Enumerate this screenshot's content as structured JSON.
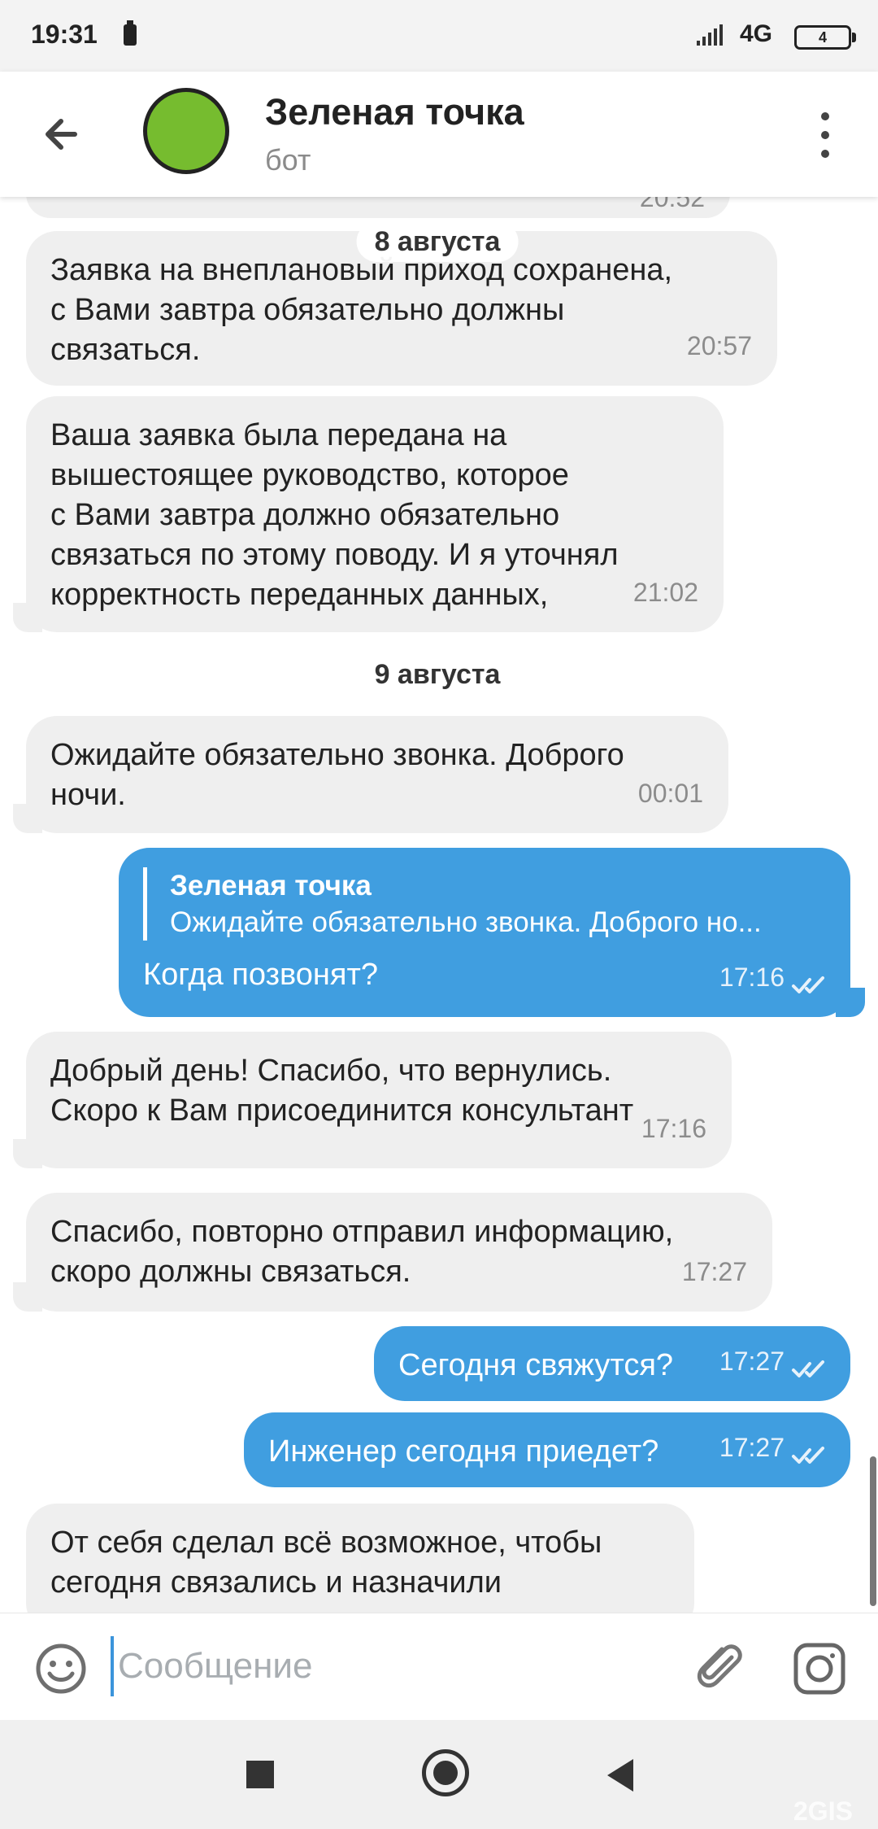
{
  "status_bar": {
    "time": "19:31",
    "network": "4G",
    "battery_level": "4",
    "signal_icon": "signal-bars-icon",
    "battery_icon": "battery-icon"
  },
  "header": {
    "title": "Зеленая точка",
    "subtitle": "бот",
    "avatar_color": "#76bc2f",
    "back_icon": "arrow-left-icon",
    "menu_icon": "more-vertical-icon"
  },
  "chat": {
    "partial_top_time": "20:52",
    "dates": [
      "8 августа",
      "9 августа"
    ],
    "messages": [
      {
        "direction": "in",
        "text": "Заявка на внеплановый приход сохранена,\nс Вами завтра обязательно должны\nсвязаться.",
        "time": "20:57"
      },
      {
        "direction": "in",
        "text": "Ваша заявка была передана на\nвышестоящее руководство, которое\nс Вами завтра должно обязательно\nсвязаться по этому поводу. И я уточнял\nкорректность переданных данных,",
        "time": "21:02"
      },
      {
        "direction": "in",
        "text": "Ожидайте обязательно звонка. Доброго\nночи.",
        "time": "00:01"
      },
      {
        "direction": "out",
        "reply_author": "Зеленая точка",
        "reply_text": "Ожидайте обязательно звонка. Доброго но...",
        "text": "Когда позвонят?",
        "time": "17:16",
        "status_icon": "double-check-icon"
      },
      {
        "direction": "in",
        "text": "Добрый день! Спасибо, что вернулись.\nСкоро к Вам присоединится консультант",
        "time": "17:16"
      },
      {
        "direction": "in",
        "text": "Спасибо, повторно отправил информацию,\nскоро должны связаться.",
        "time": "17:27"
      },
      {
        "direction": "out",
        "text": "Сегодня свяжутся?",
        "time": "17:27",
        "status_icon": "double-check-icon"
      },
      {
        "direction": "out",
        "text": "Инженер сегодня приедет?",
        "time": "17:27",
        "status_icon": "double-check-icon"
      },
      {
        "direction": "in",
        "text": "От себя сделал всё возможное, чтобы\nсегодня связались и назначили"
      }
    ]
  },
  "composer": {
    "placeholder": "Сообщение",
    "emoji_icon": "smiley-icon",
    "attach_icon": "paperclip-icon",
    "camera_icon": "camera-icon"
  },
  "navigation": {
    "recent_icon": "square-icon",
    "home_icon": "home-circle-icon",
    "back_icon": "triangle-back-icon"
  },
  "watermark": "2GIS",
  "colors": {
    "incoming_bubble": "#efefef",
    "outgoing_bubble": "#409ee0",
    "accent": "#3b94db"
  }
}
